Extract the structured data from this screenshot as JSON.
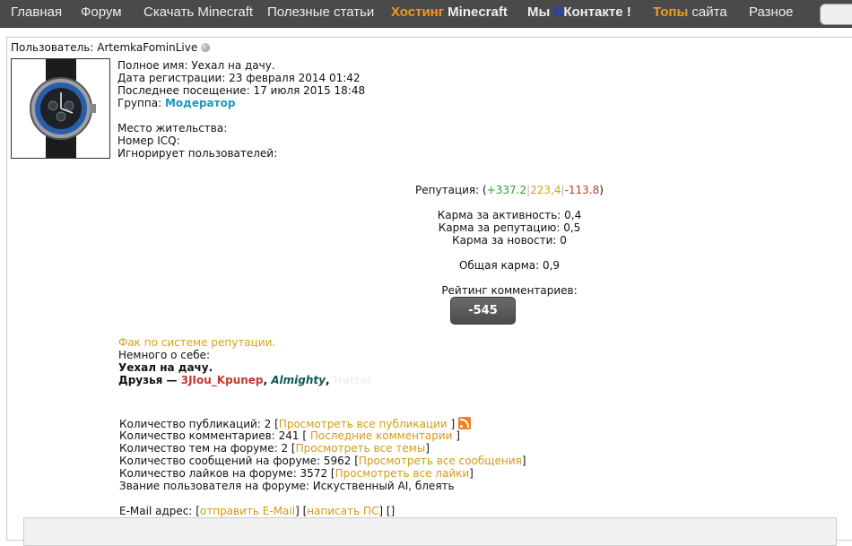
{
  "nav": {
    "home": "Главная",
    "forum": "Форум",
    "download": "Скачать Minecraft",
    "articles": "Полезные статьи",
    "hosting_a": "Хостинг",
    "hosting_b": "Minecraft",
    "vk_a": "Мы ",
    "vk_b": "В",
    "vk_c": "Контакте !",
    "tops_a": "Топы",
    "tops_b": " сайта",
    "misc": "Разное"
  },
  "profile": {
    "user_label": "Пользователь: ",
    "username": "ArtemkaFominLive",
    "full_name": "Полное имя: Уехал на дачу.",
    "registered": "Дата регистрации: 23 февраля 2014 01:42",
    "last_visit": "Последнее посещение: 17 июля 2015 18:48",
    "group_label": "Группа: ",
    "group_value": "Модератор",
    "location": "Место жительства:",
    "icq": "Номер ICQ:",
    "ignores": "Игнорирует пользователей:"
  },
  "reputation": {
    "label": "Репутация: (",
    "plus": "+337.2",
    "sep": "|",
    "neutral": "223,4",
    "minus": "-113.8",
    "close": ")"
  },
  "karma": {
    "activity": "Карма за активность: 0,4",
    "rep": "Карма за репутацию: 0,5",
    "news": "Карма за новости: 0",
    "total": "Общая карма: 0,9",
    "comment_rating_label": "Рейтинг комментариев:",
    "comment_rating_value": "-545"
  },
  "about": {
    "faq_link": "Фак по системе репутации.",
    "about_label": "Немного о себе:",
    "about_text": "Уехал на дачу.",
    "friends_label": "Друзья — ",
    "friend1": "3JIou_Kpunep",
    "comma": ", ",
    "friend2": "Almighty",
    "friend3": "Hatter"
  },
  "stats": {
    "publications": "Количество публикаций: 2 [",
    "publications_link": "Просмотреть все публикации",
    "publications_end": " ]",
    "comments": "Количество комментариев: 241 [ ",
    "comments_link": "Последние комментарии",
    "comments_end": " ]",
    "topics": "Количество тем на форуме: 2 [",
    "topics_link": "Просмотреть все темы",
    "topics_end": "]",
    "messages": "Количество сообщений на форуме: 5962 [",
    "messages_link": "Просмотреть все сообщения",
    "messages_end": "]",
    "likes": "Количество лайков на форуме: 3572 [",
    "likes_link": "Просмотреть все лайки",
    "likes_end": "]",
    "rank": "Звание пользователя на форуме: Искуственный AI, блеять",
    "email_label": "E-Mail адрес: [",
    "email_link": "отправить E-Mail",
    "email_mid": "] [",
    "pm_link": "написать ПС",
    "email_end": "] []"
  },
  "colors": {
    "nav_bg": "#4a4a4a",
    "accent_orange": "#f39a1e",
    "link_gold": "#d39b14",
    "group_teal": "#1a9bbd"
  }
}
